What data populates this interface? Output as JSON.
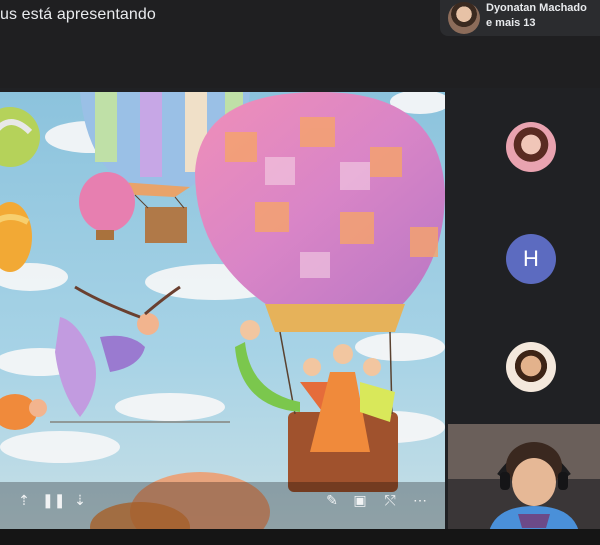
{
  "header": {
    "presenting_text": "us está apresentando",
    "participants": {
      "name": "Dyonatan Machado",
      "more": "e mais 13"
    }
  },
  "participant_tiles": [
    {
      "kind": "photo",
      "icon": "participant-avatar"
    },
    {
      "kind": "initial",
      "initial": "H",
      "color": "#5c6bc0"
    },
    {
      "kind": "photo",
      "icon": "participant-avatar"
    }
  ],
  "presentation_toolbar": {
    "icons": [
      "previous-icon",
      "pause-icon",
      "next-icon",
      "pen-icon",
      "captions-icon",
      "pointer-icon",
      "more-icon"
    ]
  },
  "colors": {
    "background": "#202124",
    "avatar_h": "#5c6bc0",
    "sky": "#8cc3dd"
  }
}
